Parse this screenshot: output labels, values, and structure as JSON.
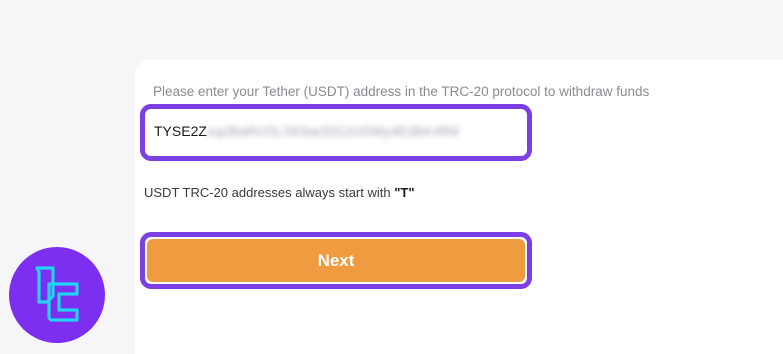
{
  "form": {
    "instruction": "Please enter your Tether (USDT) address in the TRC-20 protocol to withdraw funds",
    "address_visible": "TYSE2Z",
    "address_blurred": "xqzBaRcGLSKbw3312oSWy4EdkK4fNl",
    "hint_prefix": "USDT TRC-20 addresses always start with ",
    "hint_strong": "\"T\"",
    "next_label": "Next"
  },
  "colors": {
    "accent_border": "#7b3fe4",
    "button": "#ee9c3f",
    "logo_bg": "#7c2ff0",
    "logo_mark": "#21d4f2"
  },
  "icons": {
    "logo": "tradingfinder-logo"
  }
}
